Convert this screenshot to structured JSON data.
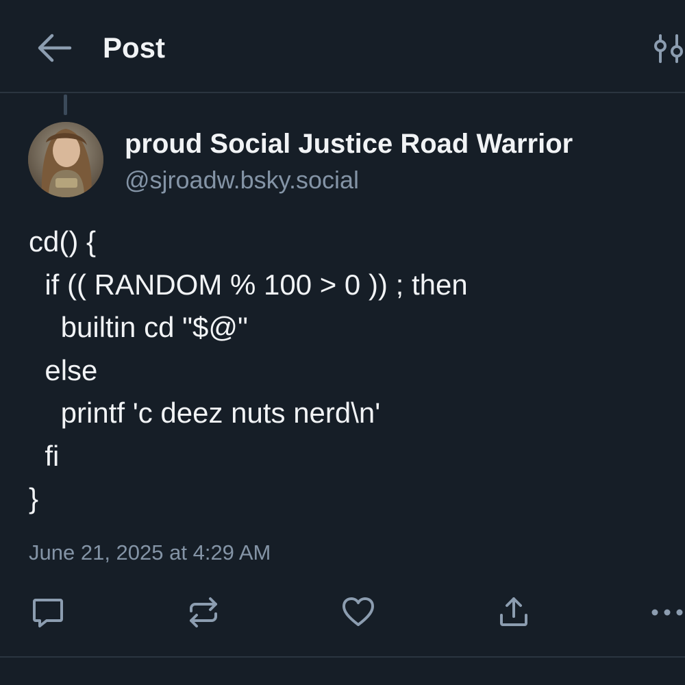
{
  "header": {
    "title": "Post",
    "back_icon": "arrow-left-icon",
    "options_icon": "sliders-icon"
  },
  "author": {
    "display_name": "proud Social Justice Road Warrior",
    "handle": "@sjroadw.bsky.social"
  },
  "post": {
    "text": "cd() {\n  if (( RANDOM % 100 > 0 )) ; then\n    builtin cd \"$@\"\n  else\n    printf 'c deez nuts nerd\\n'\n  fi\n}",
    "timestamp": "June 21, 2025 at 4:29 AM"
  },
  "actions": {
    "reply_icon": "reply-icon",
    "repost_icon": "repost-icon",
    "like_icon": "heart-icon",
    "share_icon": "share-icon",
    "more_icon": "more-icon"
  },
  "colors": {
    "background": "#161e27",
    "text": "#f1f3f5",
    "muted": "#8494a6",
    "divider": "#2b3540"
  }
}
